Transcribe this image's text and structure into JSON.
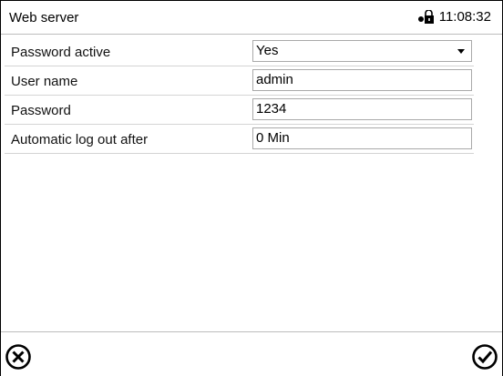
{
  "header": {
    "title": "Web server",
    "time": "11:08:32",
    "status_icon": "lock-open-icon"
  },
  "form": {
    "password_active": {
      "label": "Password active",
      "value": "Yes"
    },
    "user_name": {
      "label": "User name",
      "value": "admin"
    },
    "password": {
      "label": "Password",
      "value": "1234"
    },
    "auto_logout": {
      "label": "Automatic log out after",
      "value": "0 Min"
    }
  },
  "footer": {
    "cancel_icon": "cancel-circle-x-icon",
    "confirm_icon": "confirm-circle-check-icon"
  }
}
